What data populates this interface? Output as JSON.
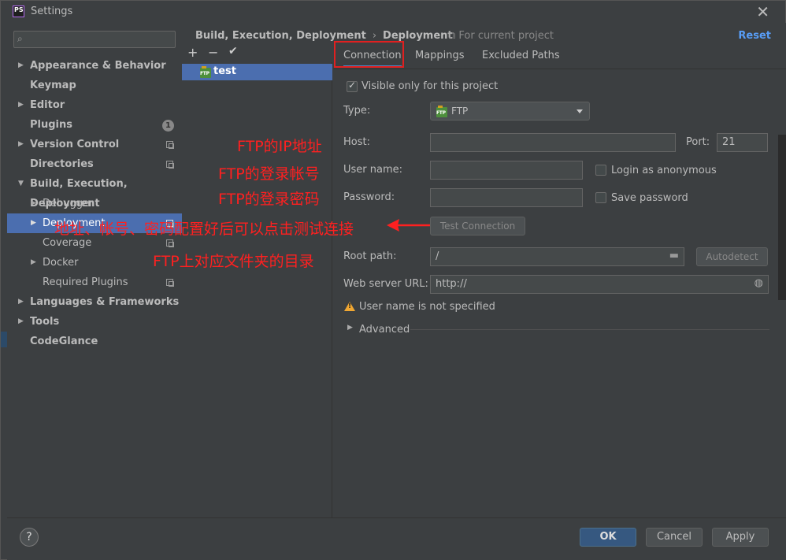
{
  "window": {
    "title": "Settings",
    "app_badge": "PS"
  },
  "search": {
    "placeholder": ""
  },
  "sidebar": {
    "items": [
      {
        "label": "Appearance & Behavior"
      },
      {
        "label": "Keymap"
      },
      {
        "label": "Editor"
      },
      {
        "label": "Plugins",
        "badge": "1"
      },
      {
        "label": "Version Control"
      },
      {
        "label": "Directories"
      },
      {
        "label": "Build, Execution, Deployment"
      },
      {
        "label": "Debugger"
      },
      {
        "label": "Deployment"
      },
      {
        "label": "Coverage"
      },
      {
        "label": "Docker"
      },
      {
        "label": "Required Plugins"
      },
      {
        "label": "Languages & Frameworks"
      },
      {
        "label": "Tools"
      },
      {
        "label": "CodeGlance"
      }
    ]
  },
  "header": {
    "crumb1": "Build, Execution, Deployment",
    "crumb2": "Deployment",
    "scope": "For current project",
    "reset": "Reset"
  },
  "servers": {
    "add": "+",
    "remove": "−",
    "apply": "✔",
    "items": [
      {
        "name": "test",
        "icon": "ftp-server-icon"
      }
    ]
  },
  "tabs": [
    "Connection",
    "Mappings",
    "Excluded Paths"
  ],
  "form": {
    "visible_only": "Visible only for this project",
    "type_label": "Type:",
    "type_value": "FTP",
    "host_label": "Host:",
    "host_value": "",
    "port_label": "Port:",
    "port_value": "21",
    "user_label": "User name:",
    "user_value": "",
    "anon_label": "Login as anonymous",
    "pass_label": "Password:",
    "pass_value": "",
    "save_label": "Save password",
    "test_button": "Test Connection",
    "root_label": "Root path:",
    "root_value": "/",
    "autodetect": "Autodetect",
    "web_label": "Web server URL:",
    "web_value": "http://",
    "warning": "User name is not specified",
    "advanced": "Advanced"
  },
  "annotations": {
    "host": "FTP的IP地址",
    "user": "FTP的登录帐号",
    "pass": "FTP的登录密码",
    "test": "地址、帐号、密码配置好后可以点击测试连接",
    "root": "FTP上对应文件夹的目录"
  },
  "footer": {
    "help": "?",
    "ok": "OK",
    "cancel": "Cancel",
    "apply": "Apply"
  },
  "colors": {
    "accent": "#4b6eaf",
    "link": "#589df6",
    "annotation": "#ff2020",
    "warning": "#f0a732"
  }
}
